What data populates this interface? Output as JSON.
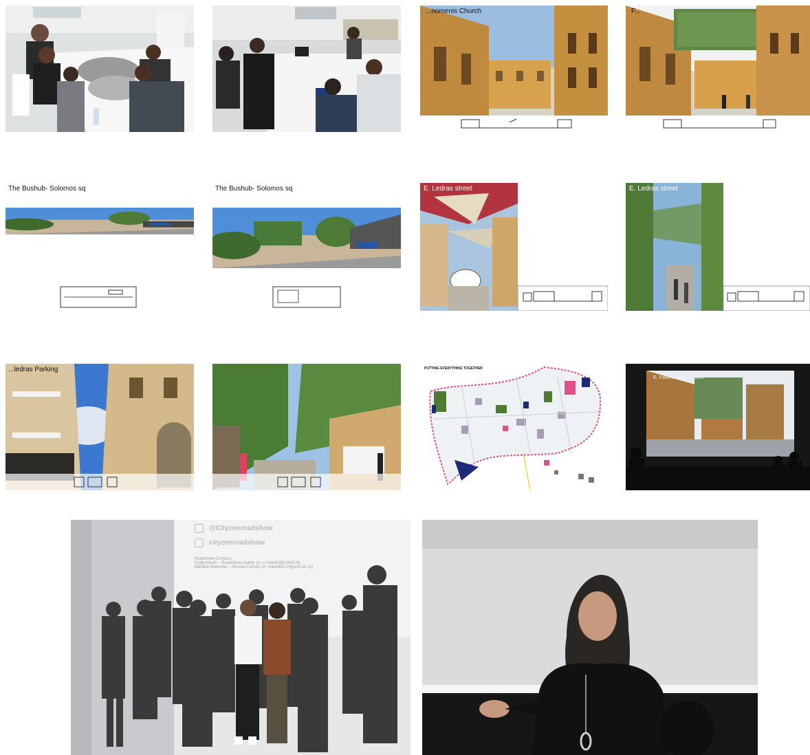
{
  "captions": {
    "church_before": "...nomenis Church",
    "church_after": "F...",
    "bushub_before": "The Bushub- Solomos sq",
    "bushub_after": "The Bushub- Solomos sq",
    "ledras_before": "E. Ledras street",
    "ledras_after": "E. Ledras street",
    "parking_before": "...ledras Parking",
    "map_title": "PUTTING EVERYTHING TOGETHER",
    "projection_caption": "E. Faneromenis Church"
  },
  "projection_screen": {
    "line1": "@Cityzenroadshow",
    "line2": "cityzenroadshow",
    "line3": "Roadshow Contacts",
    "line4": "Craig Martin – Roadshow Leader (e: c.l.martin@tudelft.nl)",
    "line5": "Marlalla Mavridou – Nicosia Contact (e: mavridou.m@unic.ac.cy)"
  },
  "colors": {
    "sky": "#8fb6e3",
    "sandstone": "#c99a4c",
    "green": "#4f7a33",
    "pink": "#e0508a",
    "navy": "#1d2a7a"
  },
  "icons": [
    "twitter-icon",
    "instagram-icon"
  ]
}
